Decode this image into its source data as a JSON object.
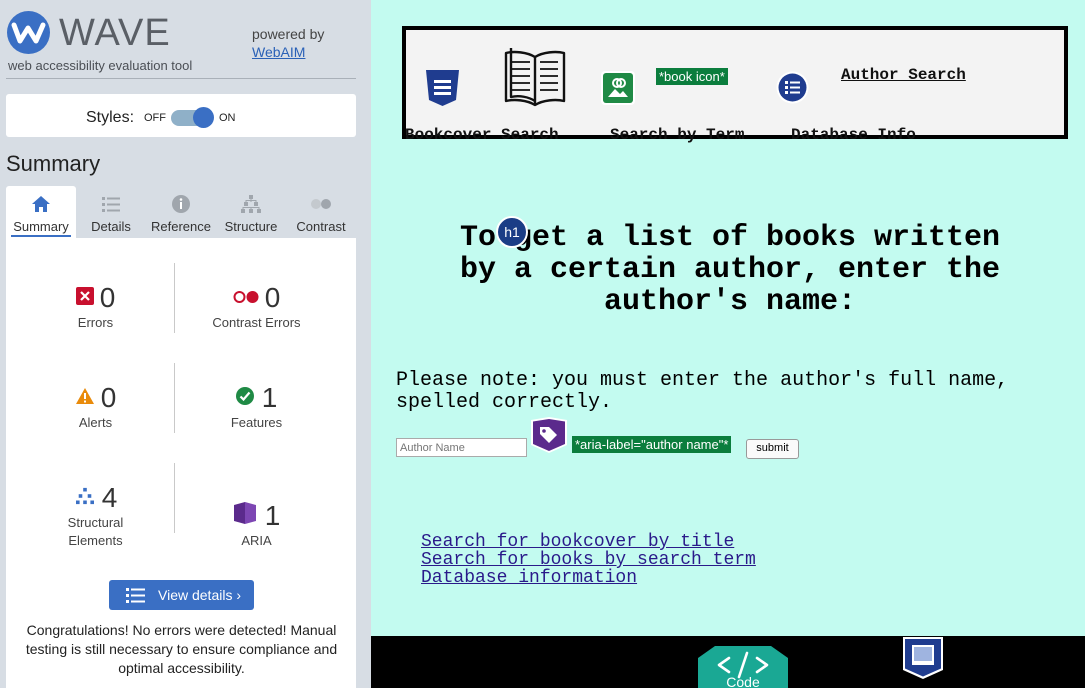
{
  "wave": {
    "logo_text": "WAVE",
    "tagline": "web accessibility evaluation tool",
    "powered_by": "powered by",
    "webaim_link": "WebAIM",
    "styles": {
      "label": "Styles:",
      "off": "OFF",
      "on": "ON",
      "state": "on"
    },
    "summary_heading": "Summary",
    "tabs": [
      {
        "label": "Summary",
        "icon": "home-icon",
        "active": true
      },
      {
        "label": "Details",
        "icon": "list-icon"
      },
      {
        "label": "Reference",
        "icon": "info-icon"
      },
      {
        "label": "Structure",
        "icon": "hierarchy-icon"
      },
      {
        "label": "Contrast",
        "icon": "contrast-icon"
      }
    ],
    "stats": {
      "errors": {
        "count": "0",
        "label": "Errors"
      },
      "contrast_errors": {
        "count": "0",
        "label": "Contrast Errors"
      },
      "alerts": {
        "count": "0",
        "label": "Alerts"
      },
      "features": {
        "count": "1",
        "label": "Features"
      },
      "structural": {
        "count": "4",
        "label_line1": "Structural",
        "label_line2": "Elements"
      },
      "aria": {
        "count": "1",
        "label": "ARIA"
      }
    },
    "view_details": "View details ›",
    "congrats": "Congratulations! No errors were detected! Manual testing is still necessary to ensure compliance and optimal accessibility."
  },
  "page": {
    "nav": {
      "bookcover": "Bookcover Search",
      "term": "Search by Term",
      "database": "Database Info",
      "author": "Author Search",
      "book_icon_tag": "*book icon*"
    },
    "h1_badge": "h1",
    "heading": "To get a list of books written by a certain author, enter the author's name:",
    "note": "Please note: you must enter the author's full name, spelled correctly.",
    "input_placeholder": "Author Name",
    "aria_tag": "*aria-label=\"author name\"*",
    "submit": "submit",
    "links": [
      "Search for bookcover by title",
      "Search for books by search term",
      "Database information"
    ],
    "footer_code_label": "Code"
  },
  "colors": {
    "wave_blue": "#3a6fc4",
    "page_bg": "#c3fbf0",
    "error_red": "#c8102e",
    "alert_orange": "#e98b0b",
    "feature_green": "#1f8a45",
    "aria_purple": "#5b2a8c",
    "wave_green_tag": "#0b7d3d"
  }
}
